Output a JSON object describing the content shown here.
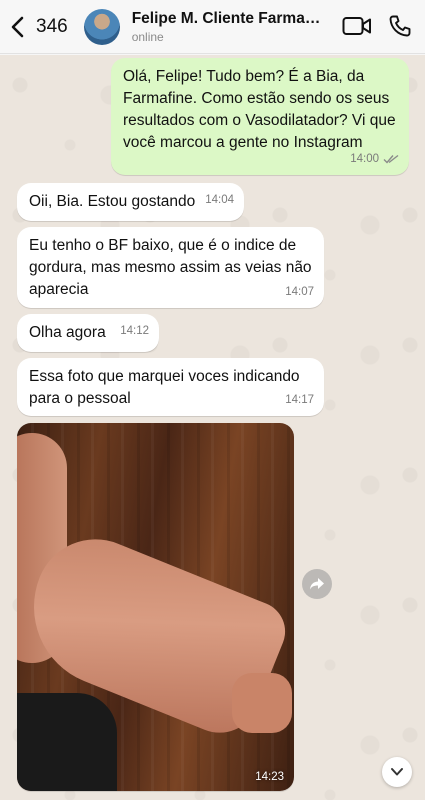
{
  "header": {
    "back_count": "346",
    "contact_name": "Felipe M. Cliente Farmafi...",
    "status": "online"
  },
  "messages": [
    {
      "text": "Olá, Felipe! Tudo bem? É a Bia, da Farmafine. Como estão sendo os seus resultados com o Vasodilatador? Vi que você marcou a gente no Instagram",
      "time": "14:00",
      "direction": "outgoing",
      "read": true
    },
    {
      "text": "Oii, Bia. Estou gostando",
      "time": "14:04",
      "direction": "incoming"
    },
    {
      "text": "Eu tenho o BF baixo, que é o indice de gordura, mas mesmo assim as veias não aparecia",
      "time": "14:07",
      "direction": "incoming"
    },
    {
      "text": "Olha agora",
      "time": "14:12",
      "direction": "incoming"
    },
    {
      "text": "Essa foto que marquei voces indicando para o pessoal",
      "time": "14:17",
      "direction": "incoming"
    },
    {
      "text": "",
      "time": "14:23",
      "direction": "incoming",
      "type": "photo"
    }
  ],
  "icons": {
    "back": "chevron-left-icon",
    "video": "video-camera-icon",
    "call": "phone-icon",
    "forward": "forward-arrow-icon",
    "scroll_down": "chevron-down-icon"
  },
  "colors": {
    "outgoing_bubble": "#dcf8c6",
    "incoming_bubble": "#ffffff",
    "chat_background": "#ece5dd",
    "read_ticks": "#8a8a8a"
  }
}
